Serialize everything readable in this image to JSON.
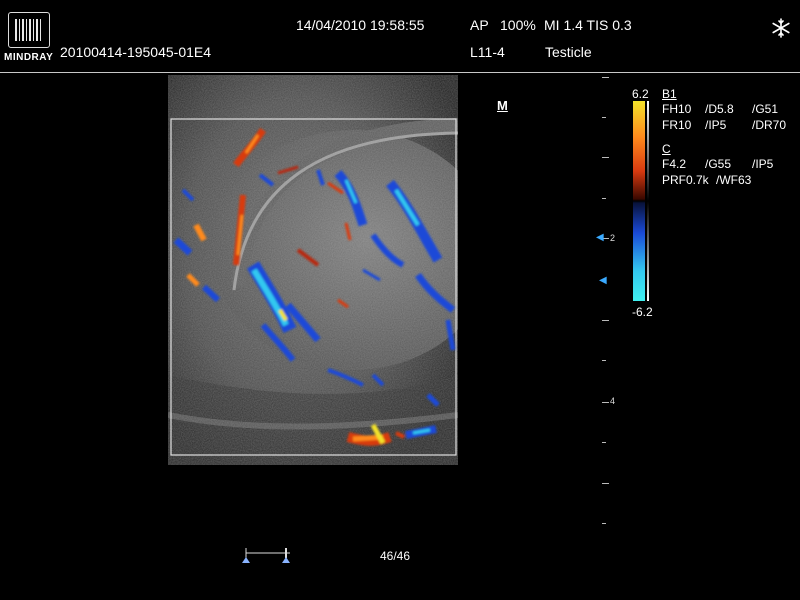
{
  "header": {
    "brand": "MINDRAY",
    "file_id": "20100414-195045-01E4",
    "datetime": "14/04/2010 19:58:55",
    "ap": "AP",
    "ap_value": "100%",
    "mi_tis": "MI 1.4 TIS 0.3",
    "probe": "L11-4",
    "preset": "Testicle",
    "freeze_icon": "snowflake-icon"
  },
  "marker": "M",
  "colorbar": {
    "max": "6.2",
    "min": "-6.2"
  },
  "params": {
    "b_title": "B1",
    "b_row1": [
      "FH10",
      "/D5.8",
      "/G51"
    ],
    "b_row2": [
      "FR10",
      "/IP5",
      "/DR70"
    ],
    "c_title": "C",
    "c_row1": [
      "F4.2",
      "/G55",
      "/IP5"
    ],
    "c_row2": [
      "PRF0.7k",
      "/WF63"
    ]
  },
  "depth_scale": {
    "label_2": "2",
    "label_4": "4"
  },
  "cine": {
    "frame": "46/46",
    "progress": 1.0
  },
  "colors": {
    "background": "#000000",
    "text": "#ffffff",
    "flow_red": "#d83a10",
    "flow_orange": "#ff8a1c",
    "flow_yellow": "#f3e22a",
    "flow_blue": "#1a4ad8",
    "flow_cyan": "#33c8f0"
  }
}
